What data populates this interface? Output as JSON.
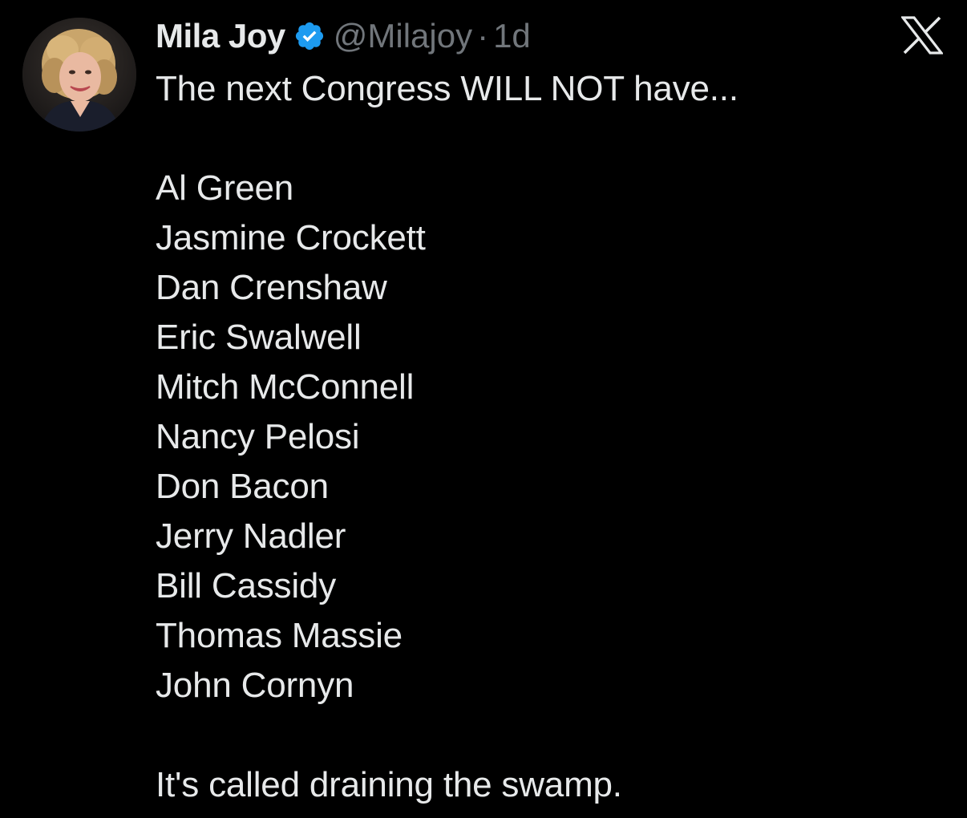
{
  "author": {
    "display_name": "Mila Joy",
    "handle": "@Milajoy",
    "separator": "·",
    "time": "1d",
    "verified": true,
    "verified_color": "#1d9bf0"
  },
  "tweet": {
    "intro": "The next Congress WILL NOT have...",
    "names": [
      "Al Green",
      "Jasmine Crockett",
      "Dan Crenshaw",
      "Eric Swalwell",
      "Mitch McConnell",
      "Nancy Pelosi",
      "Don Bacon",
      "Jerry Nadler",
      "Bill Cassidy",
      "Thomas Massie",
      "John Cornyn"
    ],
    "closing": "It's called draining the swamp."
  },
  "brand": {
    "logo": "x-logo-icon"
  },
  "colors": {
    "background": "#000000",
    "text": "#e7e9ea",
    "muted": "#71767b"
  }
}
